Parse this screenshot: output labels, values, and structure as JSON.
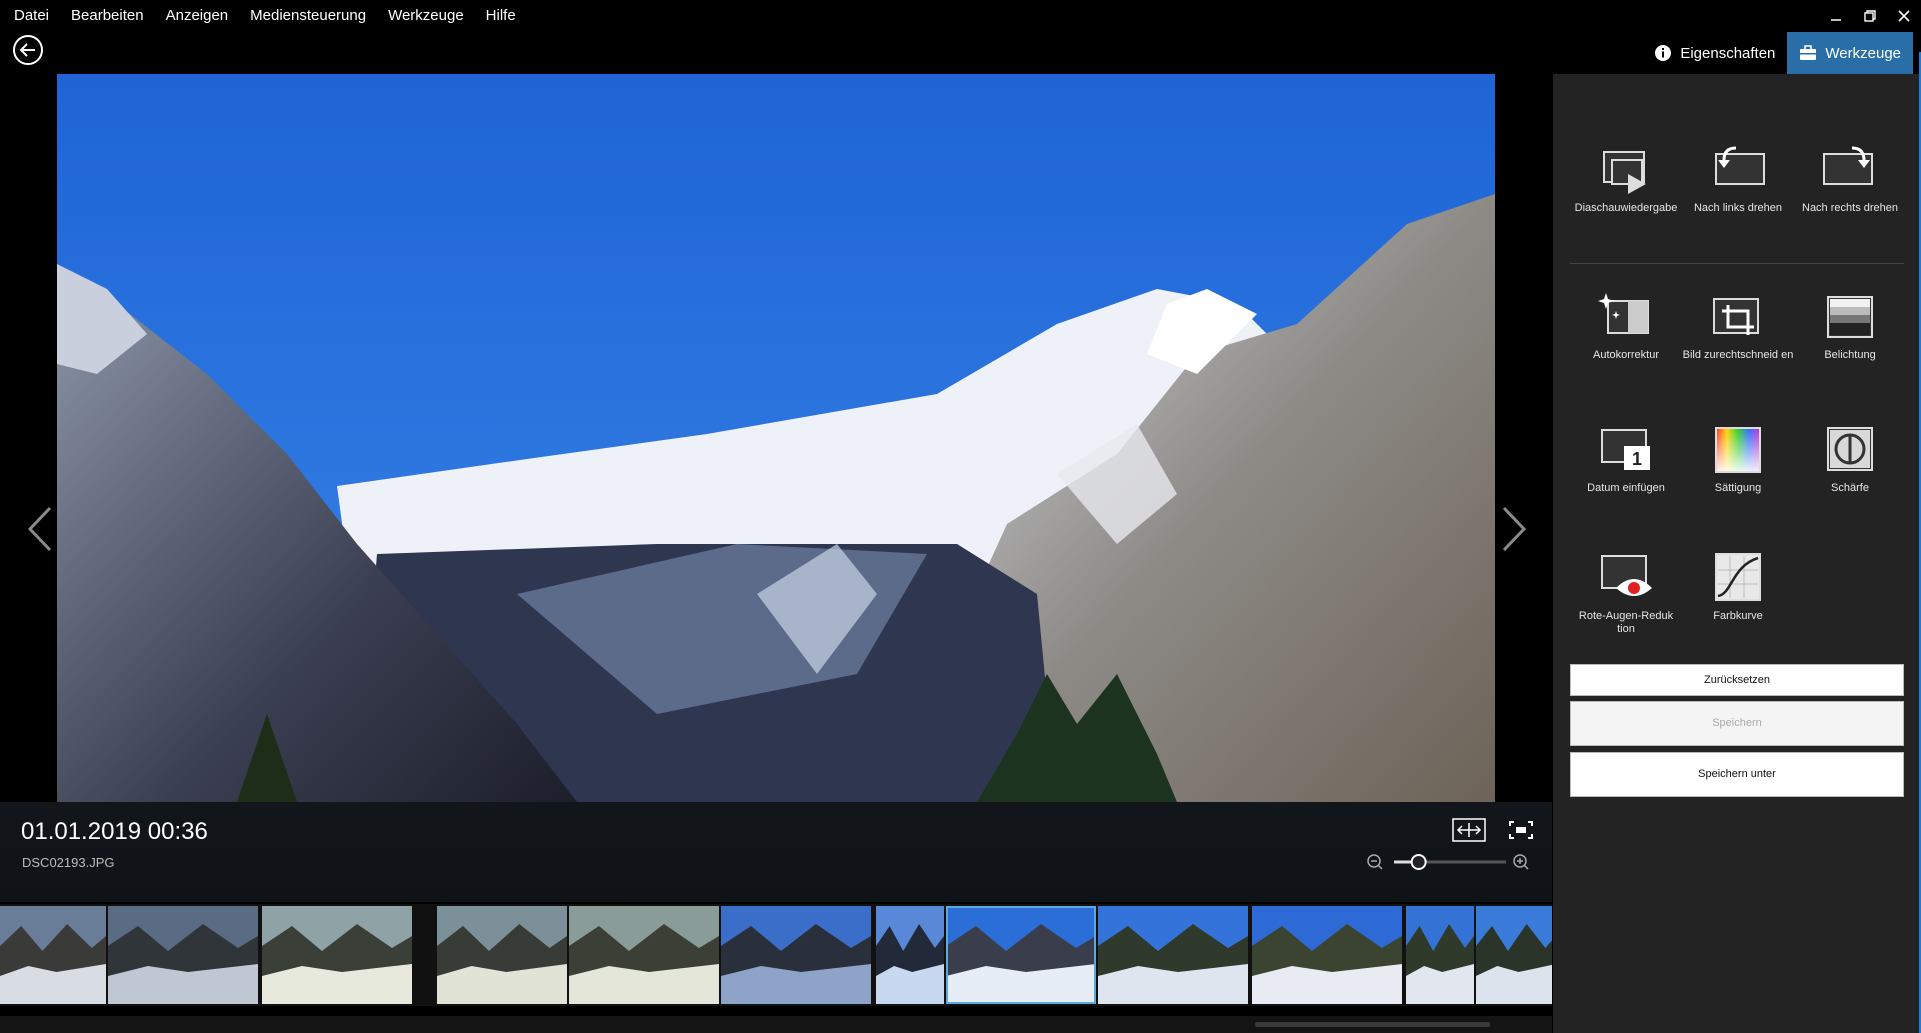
{
  "menu": [
    "Datei",
    "Bearbeiten",
    "Anzeigen",
    "Mediensteuerung",
    "Werkzeuge",
    "Hilfe"
  ],
  "window_controls": [
    "minimize-icon",
    "restore-icon",
    "close-icon"
  ],
  "header": {
    "properties_label": "Eigenschaften",
    "tools_label": "Werkzeuge",
    "active_tab": "Werkzeuge"
  },
  "info": {
    "date": "01.01.2019 00:36",
    "filename": "DSC02193.JPG"
  },
  "zoom_level": 0.22,
  "filmstrip": {
    "count": 11,
    "selected_index": 6
  },
  "tools": [
    {
      "label": "Diaschauwiedergabe",
      "icon": "slideshow-icon"
    },
    {
      "label": "Nach links drehen",
      "icon": "rotate-left-icon"
    },
    {
      "label": "Nach rechts drehen",
      "icon": "rotate-right-icon"
    },
    {
      "label": "Autokorrektur",
      "icon": "auto-correct-icon"
    },
    {
      "label": "Bild zurechtschneid en",
      "icon": "crop-icon"
    },
    {
      "label": "Belichtung",
      "icon": "exposure-icon"
    },
    {
      "label": "Datum einfügen",
      "icon": "insert-date-icon"
    },
    {
      "label": "Sättigung",
      "icon": "saturation-icon"
    },
    {
      "label": "Schärfe",
      "icon": "sharpness-icon"
    },
    {
      "label": "Rote-Augen-Reduk tion",
      "icon": "red-eye-icon"
    },
    {
      "label": "Farbkurve",
      "icon": "color-curve-icon"
    }
  ],
  "buttons": {
    "reset": "Zurücksetzen",
    "save": "Speichern",
    "save_as": "Speichern unter"
  },
  "colors": {
    "accent": "#2a6ea8",
    "panel": "#232323",
    "selection": "#5aa9e0"
  }
}
